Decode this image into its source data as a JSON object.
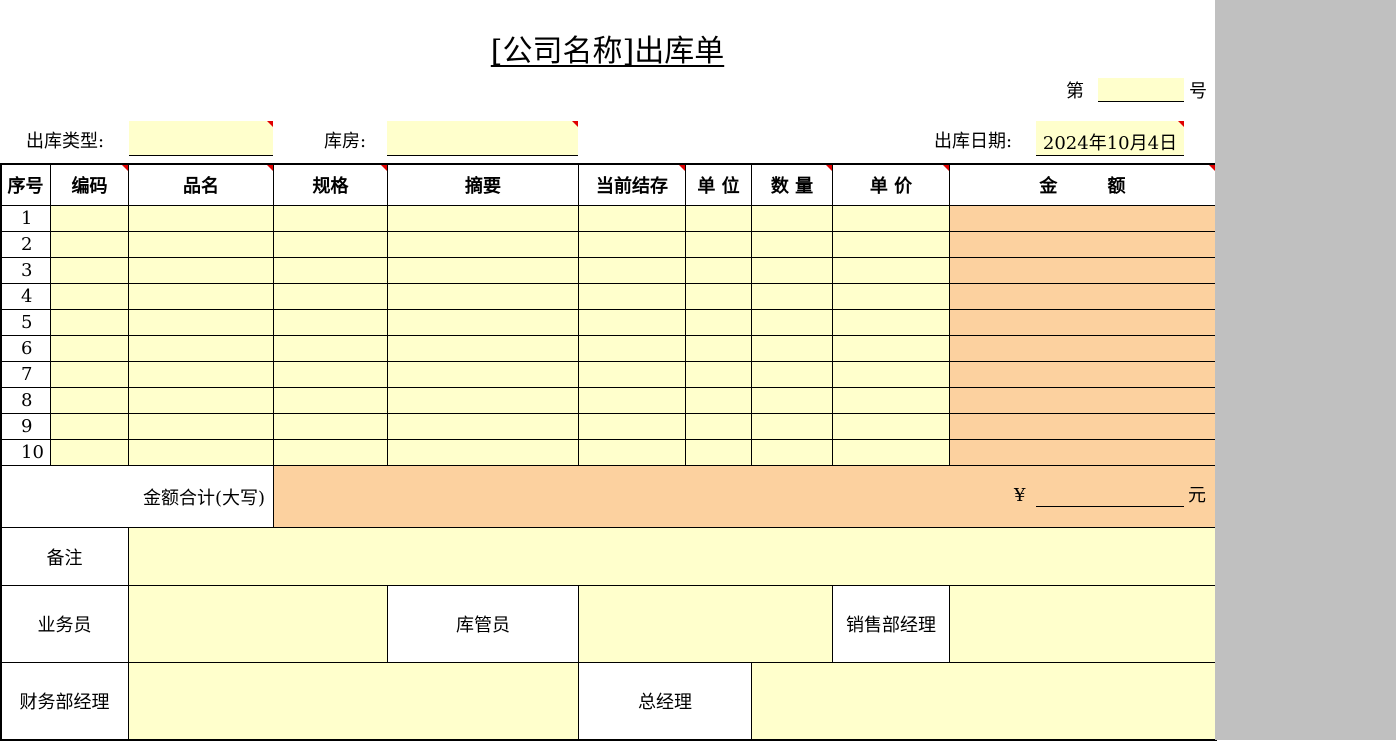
{
  "header": {
    "title": "[公司名称]出库单",
    "number_prefix": "第",
    "number_value": "",
    "number_suffix": "号",
    "type_label": "出库类型:",
    "type_value": "",
    "warehouse_label": "库房:",
    "warehouse_value": "",
    "date_label": "出库日期:",
    "date_value": "2024年10月4日"
  },
  "columns": [
    "序号",
    "编码",
    "品名",
    "规格",
    "摘要",
    "当前结存",
    "单 位",
    "数 量",
    "单 价",
    "金        额"
  ],
  "rows": [
    "1",
    "2",
    "3",
    "4",
    "5",
    "6",
    "7",
    "8",
    "9",
    "10"
  ],
  "total": {
    "label": "金额合计(大写)",
    "currency": "¥",
    "value": "",
    "unit": "元"
  },
  "remarks": {
    "label": "备注",
    "value": ""
  },
  "signatures": {
    "salesperson": "业务员",
    "warehouse_keeper": "库管员",
    "sales_manager": "销售部经理",
    "finance_manager": "财务部经理",
    "general_manager": "总经理"
  },
  "colors": {
    "input_fill": "#ffffcc",
    "amount_fill": "#fcd19f",
    "comment_marker": "#e00000",
    "margin_gray": "#c0c0c0"
  }
}
